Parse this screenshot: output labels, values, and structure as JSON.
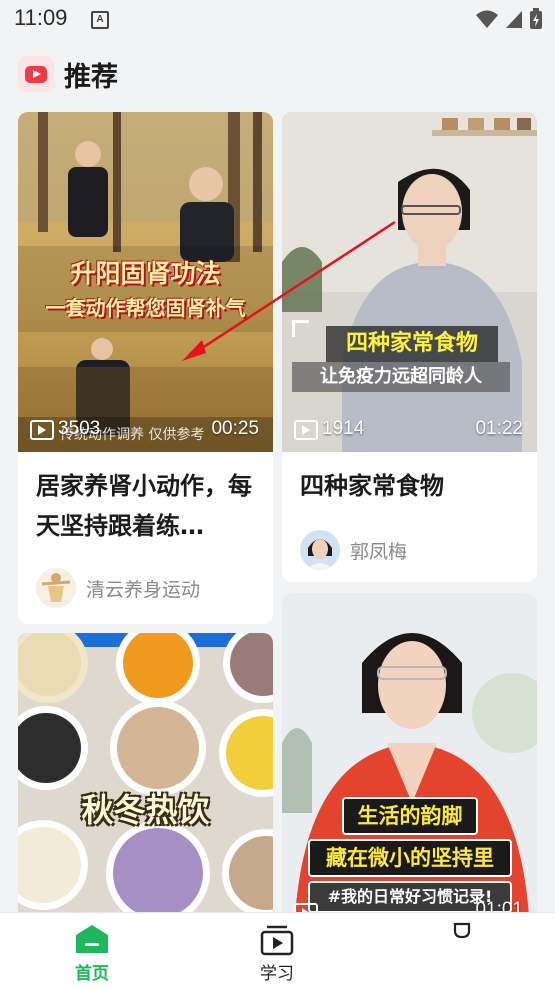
{
  "status_bar": {
    "time": "11:09",
    "notification_icon": "A"
  },
  "header": {
    "title": "推荐",
    "logo_icon": "video-play-logo"
  },
  "feed": [
    {
      "title": "居家养肾小动作，每天坚持跟着练…",
      "views": "3503",
      "duration": "00:25",
      "overlay_line1": "升阳固肾功法",
      "overlay_line2": "一套动作帮您固肾补气",
      "overlay_caption": "传统动作调养 仅供参考",
      "author": "清云养身运动"
    },
    {
      "title": "四种家常食物",
      "views": "1914",
      "duration": "01:22",
      "overlay_line1": "四种家常食物",
      "overlay_line2": "让免疫力远超同龄人",
      "author": "郭凤梅"
    },
    {
      "overlay_line1": "秋冬热饮"
    },
    {
      "overlay_line1": "生活的韵脚",
      "overlay_line2": "藏在微小的坚持里",
      "overlay_line3": "#我的日常好习惯记录!",
      "duration": "01:01"
    }
  ],
  "tabbar": [
    {
      "label": "首页",
      "icon": "home-icon",
      "active": true
    },
    {
      "label": "学习",
      "icon": "learn-video-icon",
      "active": false
    },
    {
      "label": "",
      "icon": "profile-icon",
      "active": false
    }
  ],
  "colors": {
    "accent": "#1db85b",
    "brand_red": "#ef3a4a",
    "background": "#f2f3f5"
  }
}
